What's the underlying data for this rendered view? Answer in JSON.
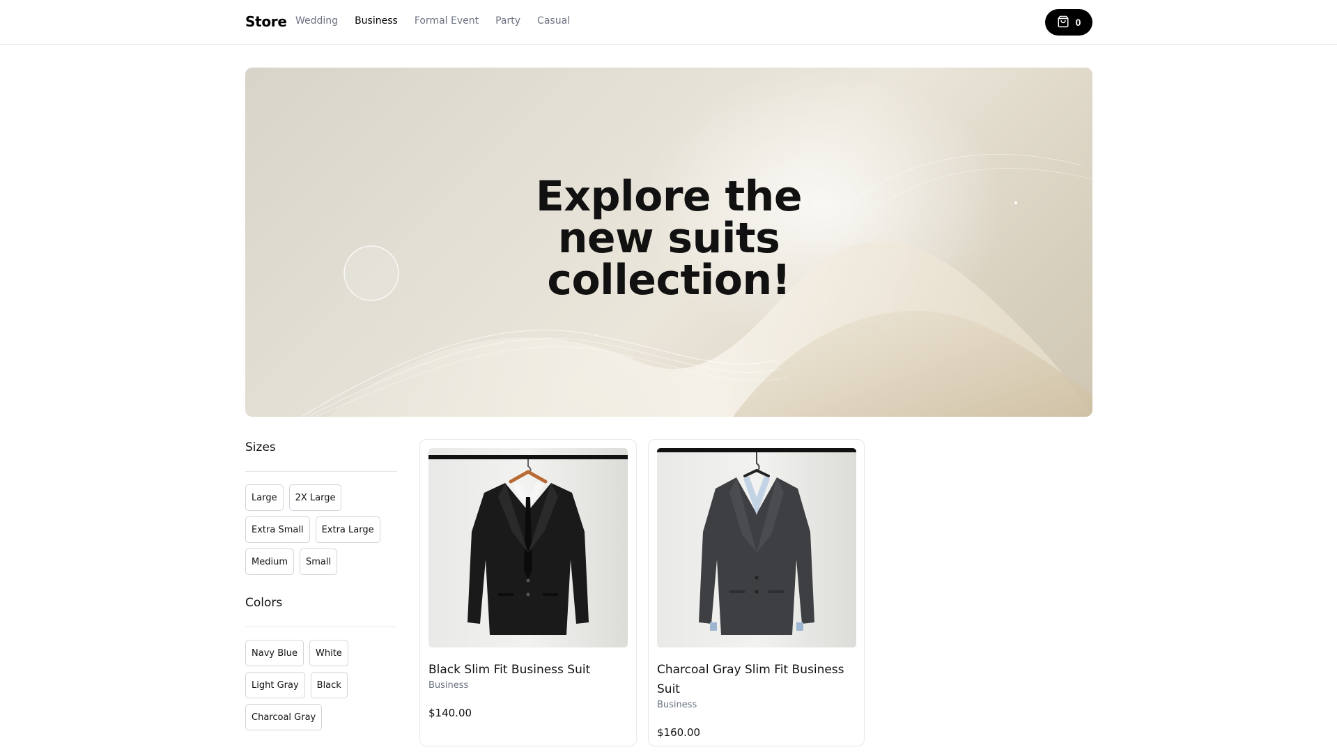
{
  "navbar": {
    "brand": "Store",
    "links": [
      "Wedding",
      "Business",
      "Formal Event",
      "Party",
      "Casual"
    ],
    "active_link": "Business",
    "cart_count": "0"
  },
  "hero": {
    "title_lines": [
      "Explore the",
      "new suits",
      "collection!"
    ]
  },
  "filters": {
    "sizes": {
      "title": "Sizes",
      "options": [
        "Large",
        "2X Large",
        "Extra Small",
        "Extra Large",
        "Medium",
        "Small"
      ]
    },
    "colors": {
      "title": "Colors",
      "options": [
        "Navy Blue",
        "White",
        "Light Gray",
        "Black",
        "Charcoal Gray"
      ]
    }
  },
  "products": [
    {
      "name": "Black Slim Fit Business Suit",
      "category": "Business",
      "price": "$140.00",
      "jacket_color": "#1a1a1a"
    },
    {
      "name": "Charcoal Gray Slim Fit Business Suit",
      "category": "Business",
      "price": "$160.00",
      "jacket_color": "#3d3f42"
    }
  ],
  "colors": {
    "accent": "#000000",
    "muted_text": "#6b7280",
    "border": "#e5e7eb"
  }
}
